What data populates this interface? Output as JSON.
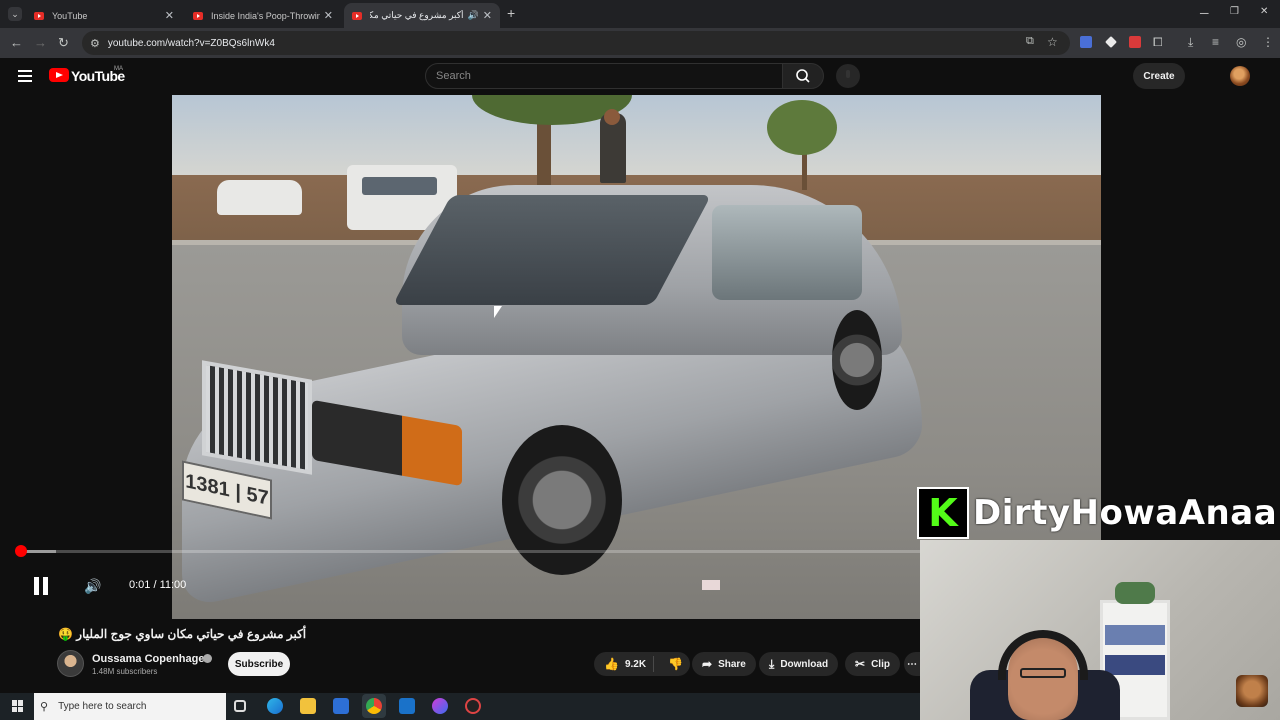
{
  "browser": {
    "tabs": [
      {
        "title": "YouTube",
        "active": false
      },
      {
        "title": "Inside India's Poop-Throwing Fe",
        "active": false
      },
      {
        "title": "أكبر مشروع في حياتي مكان ...",
        "active": true
      }
    ],
    "new_tab_symbol": "+",
    "url": "youtube.com/watch?v=Z0BQs6lnWk4",
    "window_controls": {
      "minimize": "─",
      "restore": "❐",
      "close": "✕"
    }
  },
  "youtube": {
    "logo_text": "YouTube",
    "country_code": "MA",
    "search_placeholder": "Search",
    "create_label": "Create"
  },
  "player": {
    "current_time": "0:01",
    "duration": "11:00",
    "time_display": "0:01 / 11:00",
    "progress_fraction": 0.0015,
    "buffered_fraction": 0.04
  },
  "video": {
    "title": "أكبر مشروع في حياتي مكان ساوي جوج المليار 🤑",
    "channel_name": "Oussama Copenhagen",
    "subscribers": "1.48M subscribers",
    "subscribe_label": "Subscribe",
    "like_count": "9.2K",
    "share_label": "Share",
    "download_label": "Download",
    "clip_label": "Clip",
    "more_label": "⋯",
    "plate_text": "1381 | 57"
  },
  "overlay": {
    "streamer_logo": "K",
    "streamer_name": "DirtyHowaAnaa",
    "accent_color": "#53fc18"
  },
  "taskbar": {
    "search_placeholder": "Type here to search"
  },
  "icons": [
    "hamburger-icon",
    "search-icon",
    "mic-icon",
    "pause-icon",
    "volume-icon",
    "like-icon",
    "dislike-icon",
    "share-icon",
    "download-icon",
    "clip-icon",
    "windows-start-icon"
  ]
}
